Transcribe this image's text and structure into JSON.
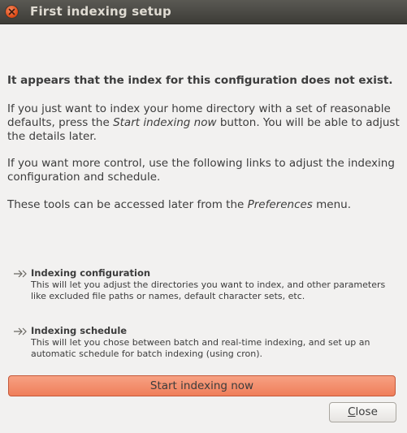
{
  "window": {
    "title": "First indexing setup"
  },
  "intro": {
    "headline": "It appears that the index for this configuration does not exist.",
    "para1_a": "If you just want to index your home directory with a set of reasonable defaults, press the ",
    "para1_em": "Start indexing now",
    "para1_b": " button. You will be able to adjust the details later.",
    "para2": "If you want more control, use the following links to adjust the indexing configuration and schedule.",
    "para3_a": "These tools can be accessed later from the ",
    "para3_em": "Preferences",
    "para3_b": " menu."
  },
  "links": [
    {
      "title": "Indexing configuration",
      "description": "This will let you adjust the directories you want to index, and other parameters like excluded file paths or names, default character sets, etc."
    },
    {
      "title": "Indexing schedule",
      "description": "This will let you chose between batch and real-time indexing, and set up an automatic  schedule for batch indexing (using cron)."
    }
  ],
  "buttons": {
    "start_label": "Start indexing now",
    "close_mnemonic": "C",
    "close_rest": "lose"
  },
  "colors": {
    "accent": "#f08a64",
    "titlebar": "#3d3c37",
    "close_icon": "#dd4814"
  },
  "icons": {
    "close": "close-icon",
    "link": "arrow-link-icon"
  }
}
